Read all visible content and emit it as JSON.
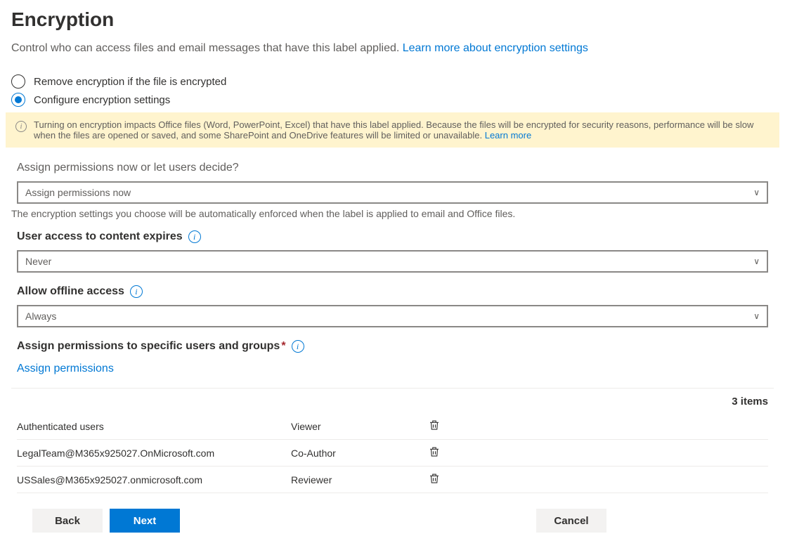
{
  "header": {
    "title": "Encryption",
    "subtitle_text": "Control who can access files and email messages that have this label applied. ",
    "learn_more": "Learn more about encryption settings"
  },
  "radio": {
    "remove": "Remove encryption if the file is encrypted",
    "configure": "Configure encryption settings"
  },
  "banner": {
    "text": "Turning on encryption impacts Office files (Word, PowerPoint, Excel) that have this label applied. Because the files will be encrypted for security reasons, performance will be slow when the files are opened or saved, and some SharePoint and OneDrive features will be limited or unavailable. ",
    "learn_more": "Learn more"
  },
  "assign_question": {
    "label": "Assign permissions now or let users decide?",
    "value": "Assign permissions now",
    "help": "The encryption settings you choose will be automatically enforced when the label is applied to email and Office files."
  },
  "expires": {
    "label": "User access to content expires",
    "value": "Never"
  },
  "offline": {
    "label": "Allow offline access",
    "value": "Always"
  },
  "specific": {
    "label": "Assign permissions to specific users and groups",
    "link": "Assign permissions"
  },
  "items_count": "3 items",
  "rows": [
    {
      "user": "Authenticated users",
      "role": "Viewer"
    },
    {
      "user": "LegalTeam@M365x925027.OnMicrosoft.com",
      "role": "Co-Author"
    },
    {
      "user": "USSales@M365x925027.onmicrosoft.com",
      "role": "Reviewer"
    }
  ],
  "buttons": {
    "back": "Back",
    "next": "Next",
    "cancel": "Cancel"
  }
}
